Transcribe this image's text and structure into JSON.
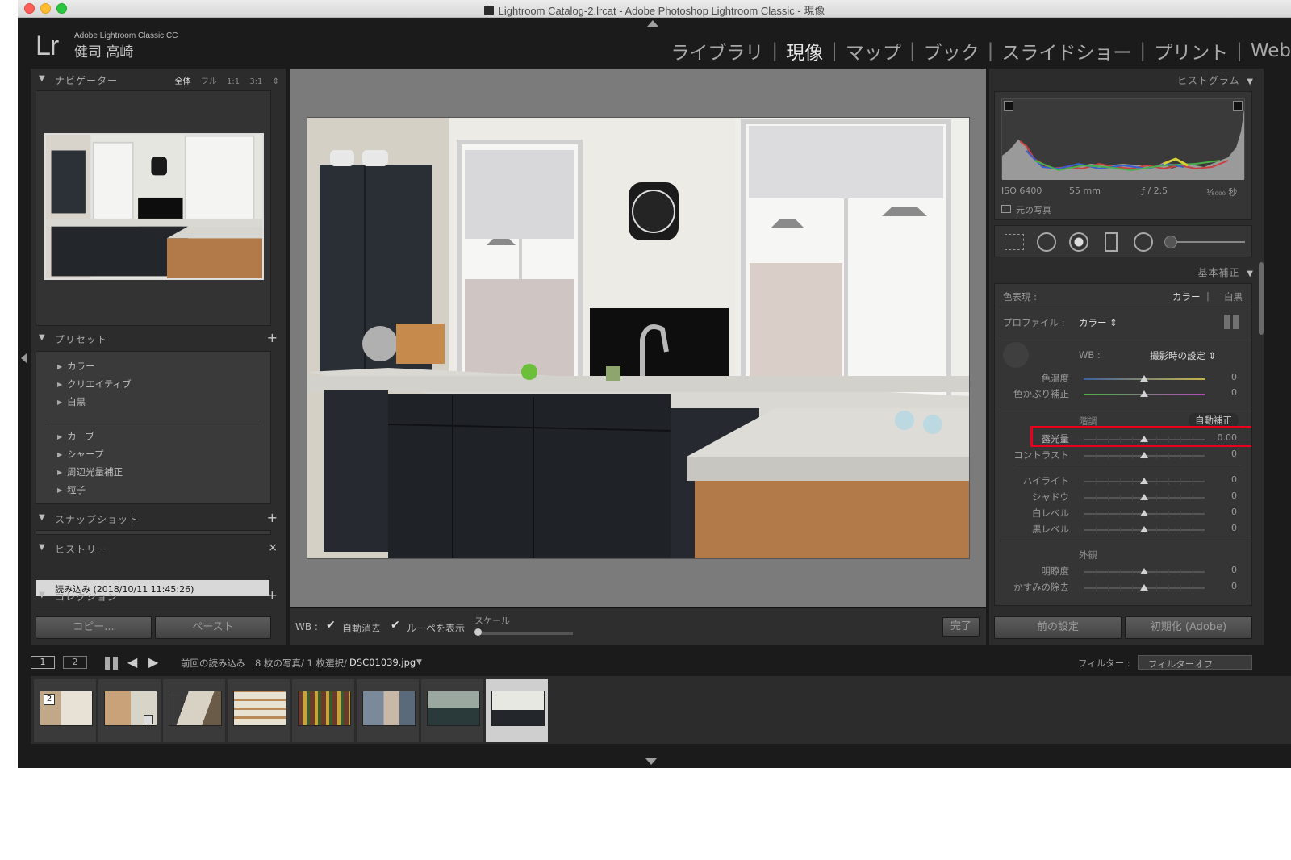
{
  "window": {
    "title": "Lightroom Catalog-2.lrcat - Adobe Photoshop Lightroom Classic - 現像"
  },
  "identity": {
    "logo": "Lr",
    "product": "Adobe Lightroom Classic CC",
    "user": "健司 高崎"
  },
  "modules": [
    {
      "label": "ライブラリ"
    },
    {
      "label": "現像",
      "active": true
    },
    {
      "label": "マップ"
    },
    {
      "label": "ブック"
    },
    {
      "label": "スライドショー"
    },
    {
      "label": "プリント"
    },
    {
      "label": "Web"
    }
  ],
  "module_separator": "|",
  "left": {
    "navigator": {
      "title": "ナビゲーター",
      "zoom": [
        "全体",
        "フル",
        "1:1",
        "3:1"
      ],
      "zoom_arrow": "⇕"
    },
    "presets": {
      "title": "プリセット",
      "plus": "+",
      "group1": [
        "カラー",
        "クリエイティブ",
        "白黒"
      ],
      "group2": [
        "カーブ",
        "シャープ",
        "周辺光量補正",
        "粒子"
      ]
    },
    "snapshots": {
      "title": "スナップショット",
      "plus": "+"
    },
    "history": {
      "title": "ヒストリー",
      "close": "×",
      "item": "読み込み (2018/10/11 11:45:26)"
    },
    "collections": {
      "title": "コレクション",
      "plus": "+"
    },
    "copy_button": "コピー...",
    "paste_button": "ペースト"
  },
  "toolbar": {
    "wb_label": "WB :",
    "auto_dismiss": "自動消去",
    "show_loupe": "ルーペを表示",
    "scale_label": "スケール",
    "done_button": "完了",
    "check": "✔"
  },
  "right": {
    "histogram": {
      "title": "ヒストグラム",
      "iso": "ISO 6400",
      "focal": "55 mm",
      "aperture": "ƒ / 2.5",
      "shutter": "¹⁄₈₀₀₀ 秒",
      "original_photo": "元の写真"
    },
    "basic": {
      "title": "基本補正",
      "treatment_label": "色表現 :",
      "treatment_color": "カラー",
      "treatment_bw": "白黒",
      "profile_label": "プロファイル :",
      "profile_value": "カラー ⇕",
      "wb_label": "WB :",
      "wb_value": "撮影時の設定 ⇕",
      "temp_label": "色温度",
      "temp_value": "0",
      "tint_label": "色かぶり補正",
      "tint_value": "0",
      "tone_label": "階調",
      "auto_button": "自動補正",
      "exposure_label": "露光量",
      "exposure_value": "0.00",
      "contrast_label": "コントラスト",
      "contrast_value": "0",
      "highlights_label": "ハイライト",
      "highlights_value": "0",
      "shadows_label": "シャドウ",
      "shadows_value": "0",
      "whites_label": "白レベル",
      "whites_value": "0",
      "blacks_label": "黒レベル",
      "blacks_value": "0",
      "presence_label": "外観",
      "clarity_label": "明瞭度",
      "clarity_value": "0",
      "dehaze_label": "かすみの除去",
      "dehaze_value": "0"
    },
    "previous_button": "前の設定",
    "reset_button": "初期化 (Adobe)"
  },
  "filmstrip": {
    "view1": "1",
    "view2": "2",
    "source": "前回の読み込み",
    "count": "8 枚の写真/ 1 枚選択/",
    "filename": "DSC01039.jpg",
    "filter_label": "フィルター :",
    "filter_value": "フィルターオフ",
    "first_badge": "2",
    "selected_index": 7,
    "thumb_count": 8
  },
  "colors": {
    "highlight_box": "#e8001c",
    "panel_bg": "#2c2c2c",
    "app_bg": "#1b1b1b",
    "center_bg": "#7b7b7b"
  },
  "icons": {
    "close": "close-icon",
    "minimize": "minimize-icon",
    "zoom": "zoom-icon",
    "crop": "crop-icon",
    "spot": "spot-removal-icon",
    "redeye": "red-eye-icon",
    "graduated": "graduated-filter-icon",
    "radial": "radial-filter-icon",
    "brush": "adjustment-brush-icon"
  }
}
